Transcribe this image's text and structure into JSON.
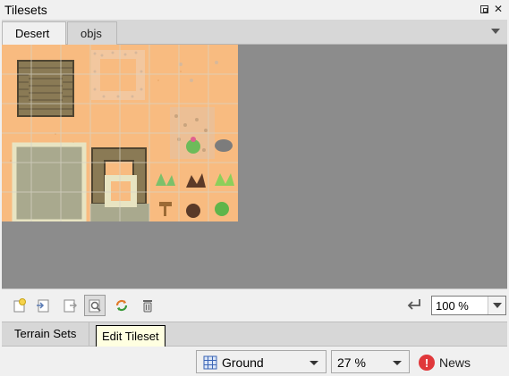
{
  "window": {
    "title": "Tilesets",
    "float_icon": "float-window-icon",
    "close_icon": "close-icon",
    "close_glyph": "✕"
  },
  "tabs": [
    {
      "label": "Desert",
      "active": true
    },
    {
      "label": "objs",
      "active": false
    }
  ],
  "tileset": {
    "name": "Desert",
    "colors": {
      "sand": "#f8bb80",
      "brick": "#7a6a4a",
      "stone": "#c8b98a",
      "cobble": "#a9a98e",
      "plant": "#7cc06a",
      "grid": "#d8d4c8"
    }
  },
  "toolbar": {
    "tools": [
      {
        "icon": "new-tileset-icon",
        "tooltip": ""
      },
      {
        "icon": "import-tileset-icon",
        "tooltip": ""
      },
      {
        "icon": "export-tileset-icon",
        "tooltip": ""
      },
      {
        "icon": "edit-tileset-icon",
        "tooltip": "Edit Tileset",
        "pressed": true
      },
      {
        "icon": "replace-tileset-icon",
        "tooltip": ""
      },
      {
        "icon": "delete-tileset-icon",
        "tooltip": ""
      }
    ],
    "dynamic_wrap_icon": "wrap-icon",
    "zoom": "100 %"
  },
  "terrain": {
    "tab_label": "Terrain Sets"
  },
  "tooltip": {
    "text": "Edit Tileset"
  },
  "statusbar": {
    "layer": "Ground",
    "layer_icon": "tile-layer-icon",
    "zoom": "27 %",
    "news_label": "News",
    "news_badge": "!"
  }
}
